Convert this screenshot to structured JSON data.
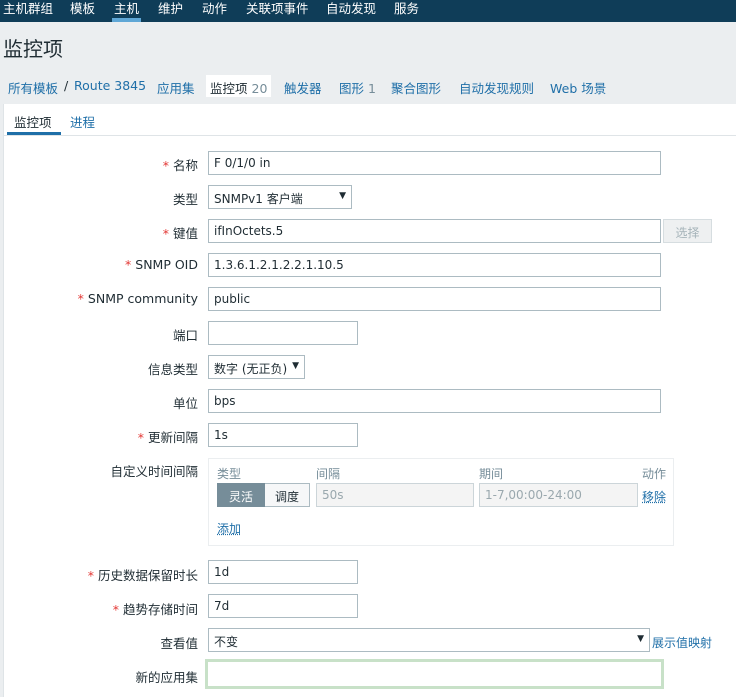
{
  "topnav": {
    "items": [
      "主机群组",
      "模板",
      "主机",
      "维护",
      "动作",
      "关联项事件",
      "自动发现",
      "服务"
    ],
    "active_index": 2
  },
  "page": {
    "title": "监控项"
  },
  "breadcrumb": {
    "all_templates": "所有模板",
    "separator": "/",
    "host": "Route 3845",
    "applications": "应用集",
    "items": "监控项",
    "items_count": "20",
    "triggers": "触发器",
    "graphs": "图形",
    "graphs_count": "1",
    "screens": "聚合图形",
    "discovery": "自动发现规则",
    "web": "Web 场景"
  },
  "tabs": {
    "item": "监控项",
    "process": "进程"
  },
  "form": {
    "name": {
      "label": "名称",
      "value": "F 0/1/0 in"
    },
    "type": {
      "label": "类型",
      "value": "SNMPv1 客户端"
    },
    "key": {
      "label": "键值",
      "value": "ifInOctets.5",
      "select_button": "选择"
    },
    "snmp_oid": {
      "label": "SNMP OID",
      "value": "1.3.6.1.2.1.2.2.1.10.5"
    },
    "snmp_community": {
      "label": "SNMP community",
      "value": "public"
    },
    "port": {
      "label": "端口",
      "value": ""
    },
    "info_type": {
      "label": "信息类型",
      "value": "数字 (无正负)"
    },
    "units": {
      "label": "单位",
      "value": "bps"
    },
    "update_interval": {
      "label": "更新间隔",
      "value": "1s"
    },
    "custom_intervals": {
      "label": "自定义时间间隔",
      "col_type": "类型",
      "col_interval": "间隔",
      "col_period": "期间",
      "col_action": "动作",
      "flexible": "灵活",
      "scheduling": "调度",
      "interval_placeholder": "50s",
      "period_placeholder": "1-7,00:00-24:00",
      "remove": "移除",
      "add": "添加"
    },
    "history": {
      "label": "历史数据保留时长",
      "value": "1d"
    },
    "trends": {
      "label": "趋势存储时间",
      "value": "7d"
    },
    "show_value": {
      "label": "查看值",
      "value": "不变",
      "mapping_link": "展示值映射"
    },
    "new_application": {
      "label": "新的应用集",
      "value": ""
    }
  },
  "colors": {
    "topbar": "#0f3d58",
    "link": "#1f6fa8",
    "required": "#e33734"
  }
}
